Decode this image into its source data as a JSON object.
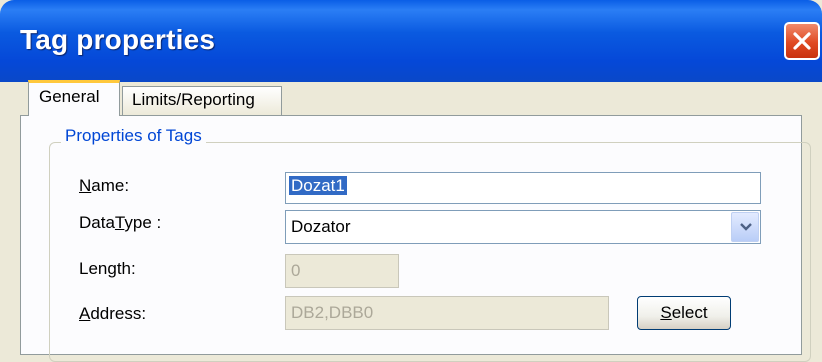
{
  "window": {
    "title": "Tag properties"
  },
  "tabs": [
    {
      "label": "General",
      "active": true
    },
    {
      "label": "Limits/Reporting",
      "active": false
    }
  ],
  "group": {
    "legend": "Properties of Tags",
    "name": {
      "label_pre": "",
      "label_key": "N",
      "label_post": "ame:",
      "value": "Dozat1"
    },
    "datatype": {
      "label_pre": "Data",
      "label_key": "T",
      "label_post": "ype :",
      "value": "Dozator"
    },
    "length": {
      "label": "Length:",
      "value": "0"
    },
    "address": {
      "label_pre": "",
      "label_key": "A",
      "label_post": "ddress:",
      "value": "DB2,DBB0"
    },
    "select_button": {
      "label_pre": "",
      "label_key": "S",
      "label_post": "elect"
    }
  },
  "colors": {
    "titlebar": "#0548d8",
    "legend": "#0046d5",
    "selection": "#316ac5",
    "close": "#e04a22"
  },
  "icons": {
    "close": "close-icon",
    "dropdown": "chevron-down-icon"
  }
}
